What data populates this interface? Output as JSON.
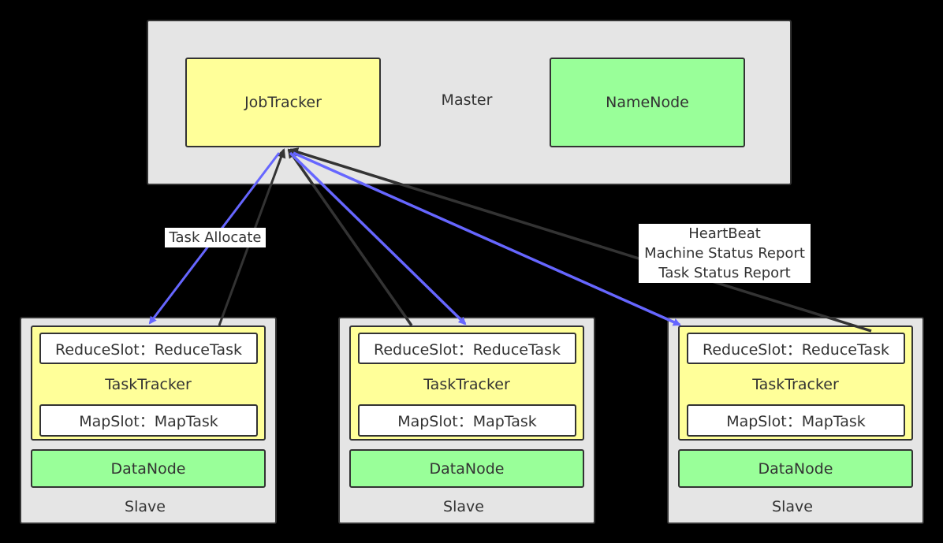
{
  "master": {
    "label": "Master",
    "job_tracker": "JobTracker",
    "name_node": "NameNode"
  },
  "slaves": [
    {
      "reduce_slot": "ReduceSlot：ReduceTask",
      "task_tracker": "TaskTracker",
      "map_slot": "MapSlot：MapTask",
      "data_node": "DataNode",
      "label": "Slave"
    },
    {
      "reduce_slot": "ReduceSlot：ReduceTask",
      "task_tracker": "TaskTracker",
      "map_slot": "MapSlot：MapTask",
      "data_node": "DataNode",
      "label": "Slave"
    },
    {
      "reduce_slot": "ReduceSlot：ReduceTask",
      "task_tracker": "TaskTracker",
      "map_slot": "MapSlot：MapTask",
      "data_node": "DataNode",
      "label": "Slave"
    }
  ],
  "edges": {
    "task_allocate": "Task Allocate",
    "report": [
      "HeartBeat",
      "Machine Status Report",
      "Task Status Report"
    ]
  },
  "colors": {
    "allocate": "#6666ff",
    "report": "#333333",
    "master_bg": "#e5e5e5",
    "tracker": "#ffff99",
    "datanode": "#99ff99"
  }
}
